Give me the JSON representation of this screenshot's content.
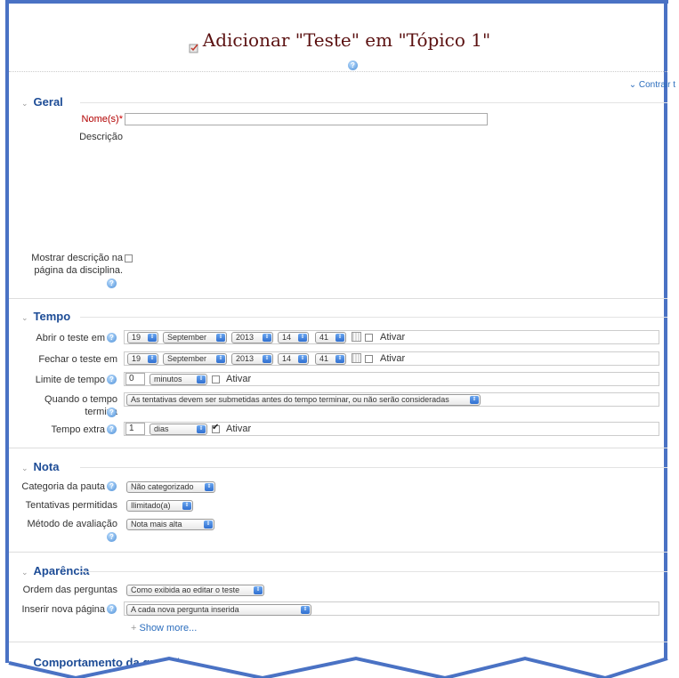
{
  "page": {
    "title": "Adicionar \"Teste\" em \"Tópico 1\"",
    "collapse_all": "Contrair t"
  },
  "geral": {
    "header": "Geral",
    "nome_label": "Nome(s)",
    "nome_required": "*",
    "descricao_label": "Descrição",
    "mostrar_label_1": "Mostrar descrição na",
    "mostrar_label_2": "página da disciplina."
  },
  "tempo": {
    "header": "Tempo",
    "abrir_label": "Abrir o teste em",
    "fechar_label": "Fechar o teste em",
    "day": "19",
    "month": "September",
    "year": "2013",
    "hour": "14",
    "minute": "41",
    "ativar": "Ativar",
    "limite_label": "Limite de tempo",
    "limite_value": "0",
    "limite_unit": "minutos",
    "quando_label_1": "Quando o tempo",
    "quando_label_2": "termina",
    "quando_value": "As tentativas devem ser submetidas antes do tempo terminar, ou não serão consideradas",
    "extra_label": "Tempo extra",
    "extra_value": "1",
    "extra_unit": "dias"
  },
  "nota": {
    "header": "Nota",
    "categoria_label": "Categoria da pauta",
    "categoria_value": "Não categorizado",
    "tentativas_label": "Tentativas permitidas",
    "tentativas_value": "Ilimitado(a)",
    "metodo_label": "Método de avaliação",
    "metodo_value": "Nota mais alta"
  },
  "aparencia": {
    "header": "Aparência",
    "ordem_label": "Ordem das perguntas",
    "ordem_value": "Como exibida ao editar o teste",
    "inserir_label": "Inserir nova página",
    "inserir_value": "A cada nova pergunta inserida",
    "show_more": "Show more..."
  },
  "comportamento": {
    "header": "Comportamento da questão"
  }
}
